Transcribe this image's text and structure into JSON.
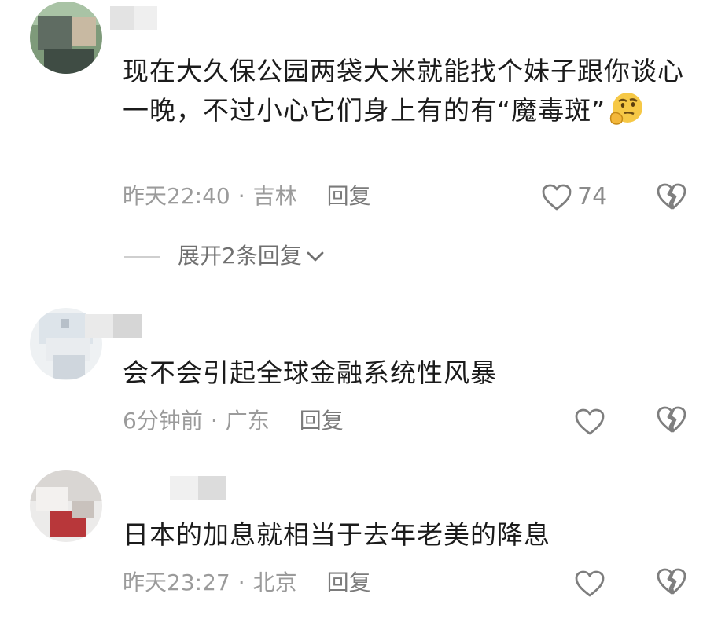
{
  "comments": [
    {
      "text": "现在大久保公园两袋大米就能找个妹子跟你谈心一晚，不过小心它们身上有的有“魔毒斑”",
      "emoji": "thinking-face",
      "time": "昨天22:40",
      "location": "吉林",
      "reply_label": "回复",
      "likes": "74",
      "expand_label": "展开2条回复"
    },
    {
      "text": "会不会引起全球金融系统性风暴",
      "time": "6分钟前",
      "location": "广东",
      "reply_label": "回复"
    },
    {
      "text": "日本的加息就相当于去年老美的降息",
      "time": "昨天23:27",
      "location": "北京",
      "reply_label": "回复"
    }
  ],
  "separator": "·",
  "colors": {
    "text": "#1b1b1b",
    "meta": "#9b9b9b",
    "icon": "#8b8b8b"
  }
}
